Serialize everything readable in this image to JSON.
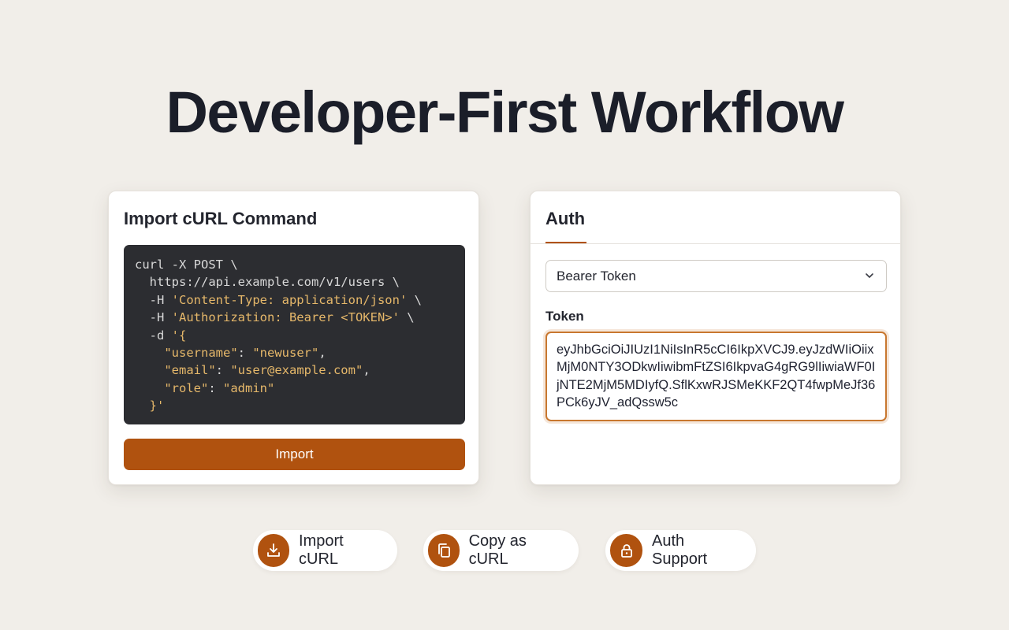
{
  "page": {
    "title": "Developer-First Workflow"
  },
  "import_card": {
    "heading": "Import cURL Command",
    "code_lines": [
      [
        {
          "t": "curl -X POST \\",
          "c": "plain"
        }
      ],
      [
        {
          "t": "  https://api.example.com/v1/users \\",
          "c": "plain"
        }
      ],
      [
        {
          "t": "  -H ",
          "c": "plain"
        },
        {
          "t": "'Content-Type: application/json'",
          "c": "str"
        },
        {
          "t": " \\",
          "c": "plain"
        }
      ],
      [
        {
          "t": "  -H ",
          "c": "plain"
        },
        {
          "t": "'Authorization: Bearer <TOKEN>'",
          "c": "str"
        },
        {
          "t": " \\",
          "c": "plain"
        }
      ],
      [
        {
          "t": "  -d ",
          "c": "plain"
        },
        {
          "t": "'{",
          "c": "str"
        }
      ],
      [
        {
          "t": "    \"username\"",
          "c": "str"
        },
        {
          "t": ": ",
          "c": "plain"
        },
        {
          "t": "\"newuser\"",
          "c": "str"
        },
        {
          "t": ",",
          "c": "plain"
        }
      ],
      [
        {
          "t": "    \"email\"",
          "c": "str"
        },
        {
          "t": ": ",
          "c": "plain"
        },
        {
          "t": "\"user@example.com\"",
          "c": "str"
        },
        {
          "t": ",",
          "c": "plain"
        }
      ],
      [
        {
          "t": "    \"role\"",
          "c": "str"
        },
        {
          "t": ": ",
          "c": "plain"
        },
        {
          "t": "\"admin\"",
          "c": "str"
        }
      ],
      [
        {
          "t": "  }'",
          "c": "str"
        }
      ]
    ],
    "import_button_label": "Import"
  },
  "auth_card": {
    "tab_label": "Auth",
    "auth_type_selected": "Bearer Token",
    "token_label": "Token",
    "token_value": "eyJhbGciOiJIUzI1NiIsInR5cCI6IkpXVCJ9.eyJzdWIiOiixMjM0NTY3ODkwIiwibmFtZSI6IkpvaG4gRG9lIiwiaWF0IjNTE2MjM5MDIyfQ.SflKxwRJSMeKKF2QT4fwpMeJf36PCk6yJV_adQssw5c"
  },
  "features": [
    {
      "label": "Import cURL",
      "icon": "download-icon"
    },
    {
      "label": "Copy as cURL",
      "icon": "copy-icon"
    },
    {
      "label": "Auth Support",
      "icon": "lock-icon"
    }
  ],
  "colors": {
    "accent": "#b0520f",
    "background": "#f1eee9",
    "code_bg": "#2c2d31",
    "code_string": "#e6b86a"
  }
}
